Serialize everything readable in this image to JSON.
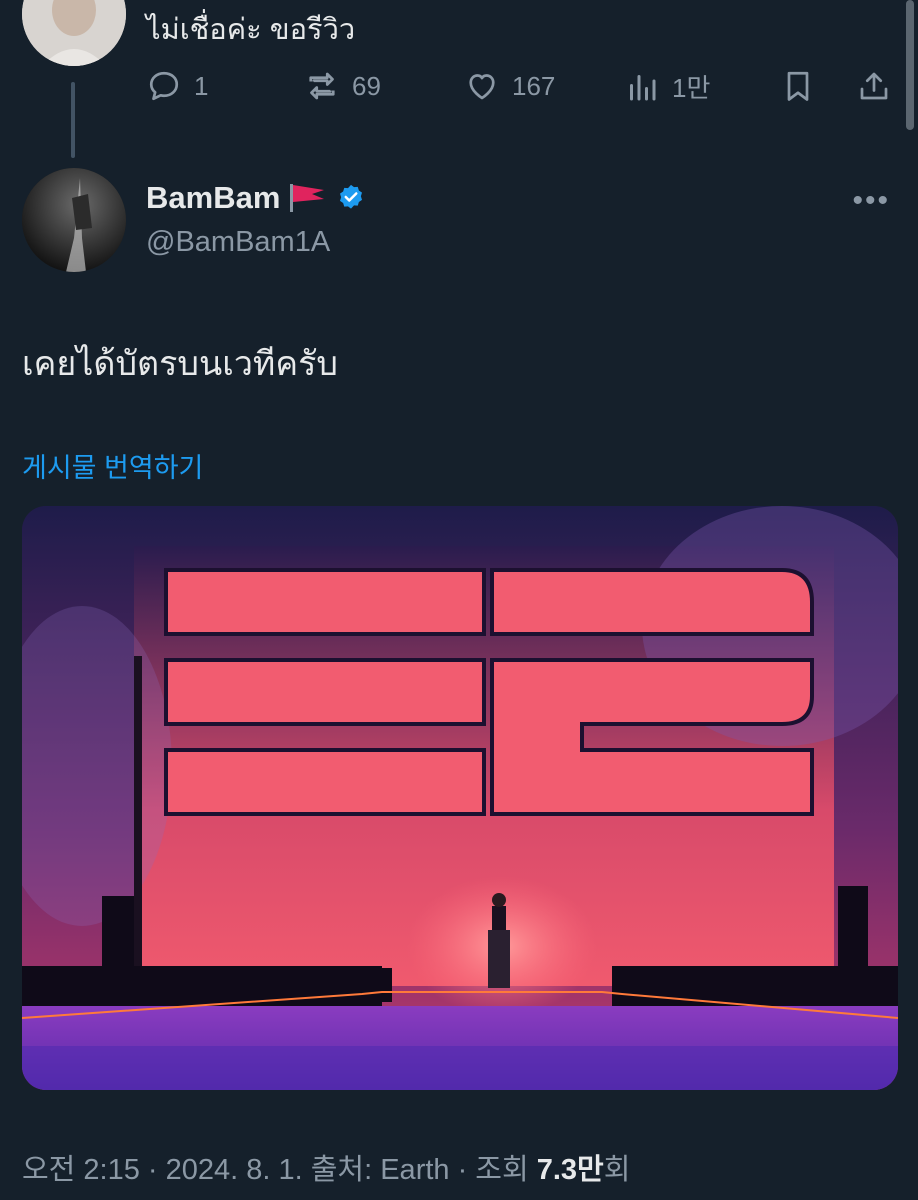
{
  "previous_tweet": {
    "text": "ไม่เชื่อค่ะ ขอรีวิว",
    "actions": {
      "reply_count": "1",
      "retweet_count": "69",
      "like_count": "167",
      "views_count": "1만"
    }
  },
  "tweet": {
    "display_name": "BamBam",
    "handle": "@BamBam1A",
    "text": "เคยได้บัตรบนเวทีครับ",
    "translate_label": "게시물 번역하기",
    "meta": {
      "time": "오전 2:15 · 2024. 8. 1. 출처: Earth · 조회 ",
      "views_value": "7.3만",
      "views_suffix": "회"
    }
  },
  "colors": {
    "background": "#15202b",
    "text_primary": "#e7e9ea",
    "text_secondary": "#8b98a5",
    "link": "#1d9bf0",
    "verified": "#1d9bf0",
    "flag": "#e0245e"
  },
  "icons": [
    "reply-icon",
    "retweet-icon",
    "like-icon",
    "views-icon",
    "bookmark-icon",
    "share-icon",
    "verified-badge-icon",
    "red-flag-emoji",
    "more-options-icon"
  ]
}
